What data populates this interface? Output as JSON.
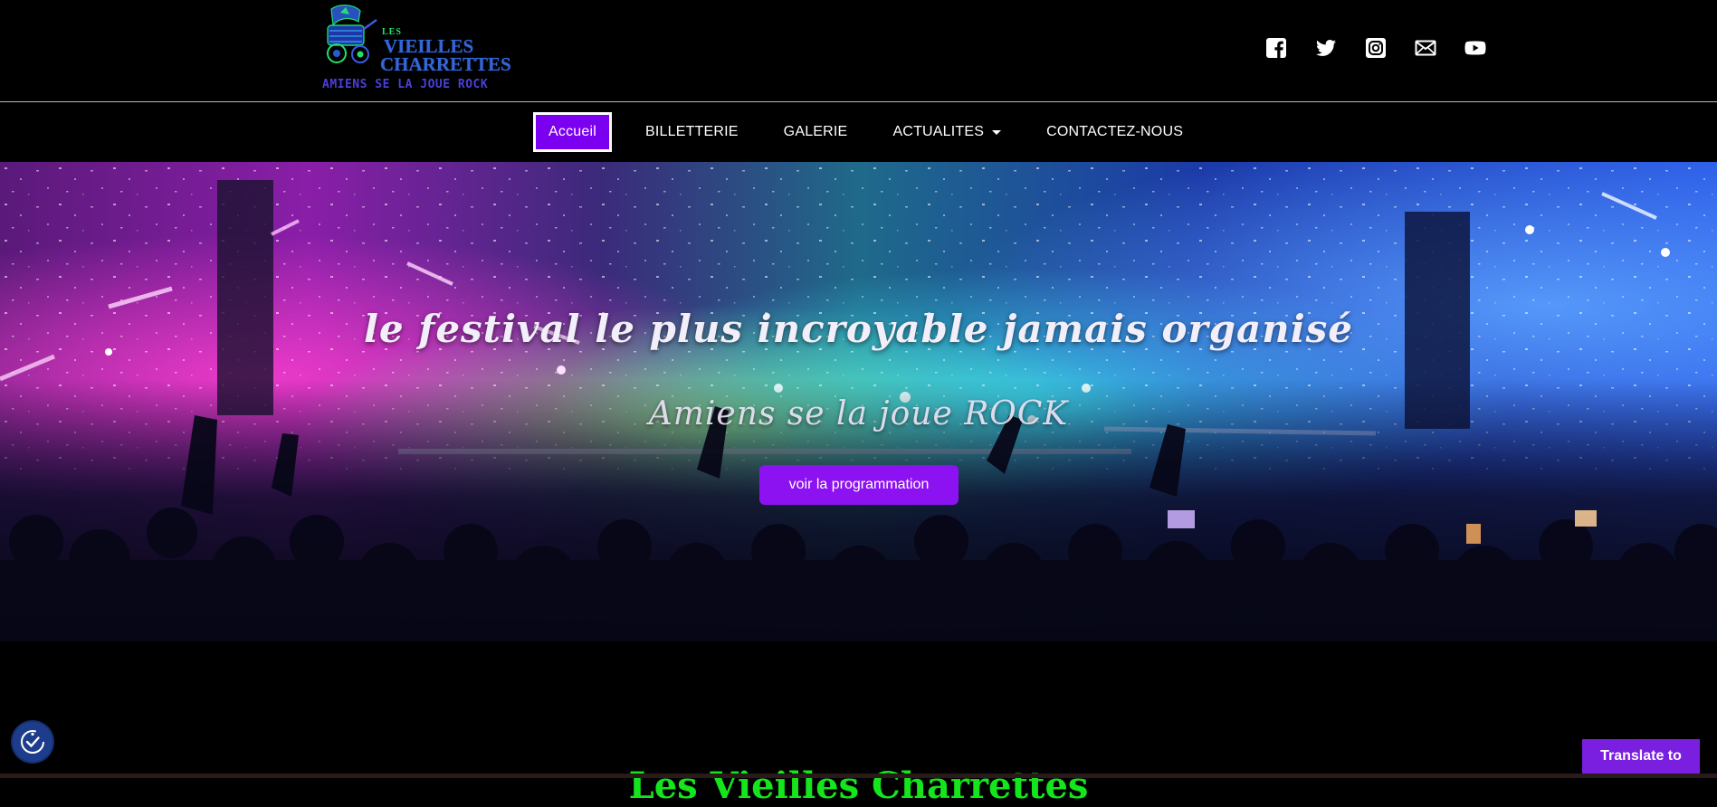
{
  "header": {
    "logo": {
      "small": "LES",
      "line1": "VIEILLES",
      "line2": "CHARRETTES",
      "tagline": "AMIENS SE LA JOUE ROCK"
    },
    "social": [
      {
        "name": "facebook-icon"
      },
      {
        "name": "twitter-icon"
      },
      {
        "name": "instagram-icon"
      },
      {
        "name": "mail-icon"
      },
      {
        "name": "youtube-icon"
      }
    ]
  },
  "nav": {
    "items": [
      {
        "label": "Accueil",
        "active": true
      },
      {
        "label": "BILLETTERIE"
      },
      {
        "label": "GALERIE"
      },
      {
        "label": "ACTUALITES",
        "has_dropdown": true
      },
      {
        "label": "CONTACTEZ-NOUS"
      }
    ]
  },
  "hero": {
    "title": "le festival le plus incroyable jamais organisé",
    "subtitle": "Amiens se la joue ROCK",
    "cta_label": "voir la programmation"
  },
  "section": {
    "title": "Les Vieilles Charrettes"
  },
  "widgets": {
    "accessibility_icon": "accessibility-icon",
    "translate_label": "Translate to"
  },
  "colors": {
    "accent": "#7b00f0",
    "cta": "#8d12f2",
    "section_title": "#14e51c",
    "translate": "#7a1fe0"
  }
}
